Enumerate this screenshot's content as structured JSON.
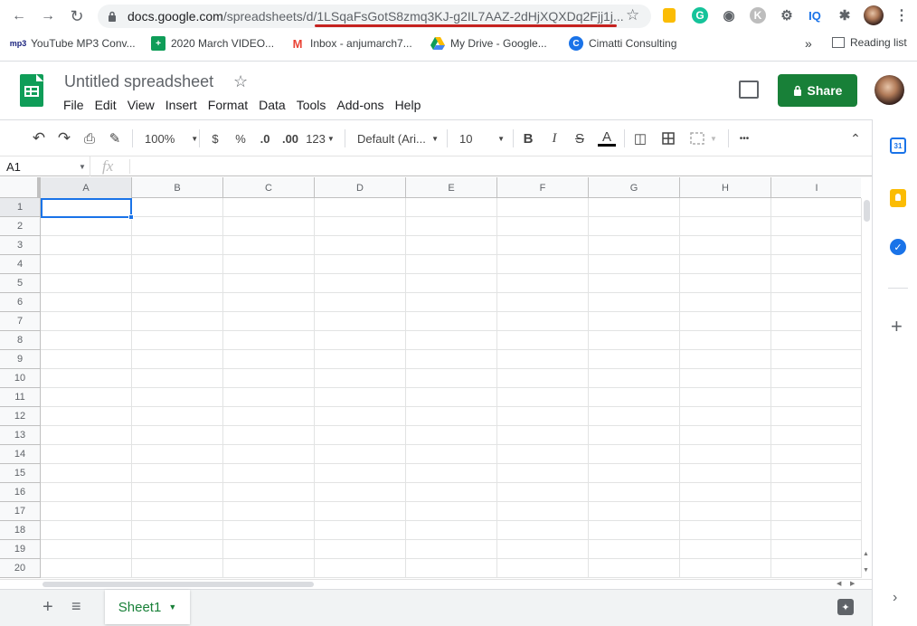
{
  "browser": {
    "url_domain": "docs.google.com",
    "url_path": "/spreadsheets/d/1LSqaFsGotS8zmq3KJ-g2IL7AAZ-2dHjXQXDq2Fjj1j...",
    "ext_k": "K",
    "ext_iq": "IQ",
    "bookmarks": [
      {
        "label": "YouTube MP3 Conv..."
      },
      {
        "label": "2020 March VIDEO..."
      },
      {
        "label": "Inbox - anjumarch7..."
      },
      {
        "label": "My Drive - Google..."
      },
      {
        "label": "Cimatti Consulting"
      }
    ],
    "more_bookmarks": "»",
    "reading_list": "Reading list"
  },
  "sheets": {
    "title": "Untitled spreadsheet",
    "menus": [
      "File",
      "Edit",
      "View",
      "Insert",
      "Format",
      "Data",
      "Tools",
      "Add-ons",
      "Help"
    ],
    "share_label": "Share",
    "toolbar": {
      "zoom": "100%",
      "currency": "$",
      "percent": "%",
      "dec_decrease": ".0",
      "dec_increase": ".00",
      "more_formats": "123",
      "font": "Default (Ari...",
      "font_size": "10",
      "bold": "B",
      "italic": "I",
      "strike": "S",
      "text_color": "A",
      "more": "•••"
    },
    "name_box": "A1",
    "fx": "fx",
    "columns": [
      "A",
      "B",
      "C",
      "D",
      "E",
      "F",
      "G",
      "H",
      "I"
    ],
    "rows": [
      "1",
      "2",
      "3",
      "4",
      "5",
      "6",
      "7",
      "8",
      "9",
      "10",
      "11",
      "12",
      "13",
      "14",
      "15",
      "16",
      "17",
      "18",
      "19",
      "20"
    ],
    "sheet_tab": "Sheet1"
  },
  "colors": {
    "accent_green": "#188038",
    "select_blue": "#1a73e8",
    "url_underline": "#c5221f"
  }
}
